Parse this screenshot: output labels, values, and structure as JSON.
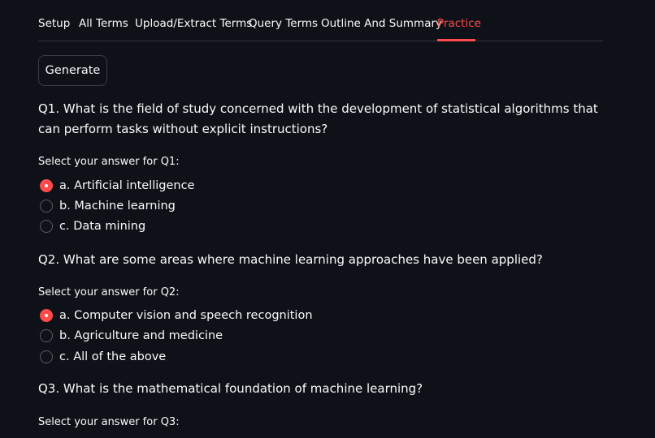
{
  "tabs": [
    {
      "label": "Setup"
    },
    {
      "label": "All Terms"
    },
    {
      "label": "Upload/Extract Terms"
    },
    {
      "label": "Query Terms"
    },
    {
      "label": "Outline And Summary"
    },
    {
      "label": "Practice",
      "active": true
    }
  ],
  "generate_button": {
    "label": "Generate"
  },
  "questions": [
    {
      "text": "Q1. What is the field of study concerned with the development of statistical algorithms that can perform tasks without explicit instructions?",
      "select_label": "Select your answer for Q1:",
      "options": [
        {
          "label": "a. Artificial intelligence",
          "selected": true
        },
        {
          "label": "b. Machine learning",
          "selected": false
        },
        {
          "label": "c. Data mining",
          "selected": false
        }
      ]
    },
    {
      "text": "Q2. What are some areas where machine learning approaches have been applied?",
      "select_label": "Select your answer for Q2:",
      "options": [
        {
          "label": "a. Computer vision and speech recognition",
          "selected": true
        },
        {
          "label": "b. Agriculture and medicine",
          "selected": false
        },
        {
          "label": "c. All of the above",
          "selected": false
        }
      ]
    },
    {
      "text": "Q3. What is the mathematical foundation of machine learning?",
      "select_label": "Select your answer for Q3:"
    }
  ],
  "colors": {
    "background": "#0e1117",
    "text": "#fafafa",
    "accent": "#ff4b4b",
    "border": "#31333f"
  }
}
